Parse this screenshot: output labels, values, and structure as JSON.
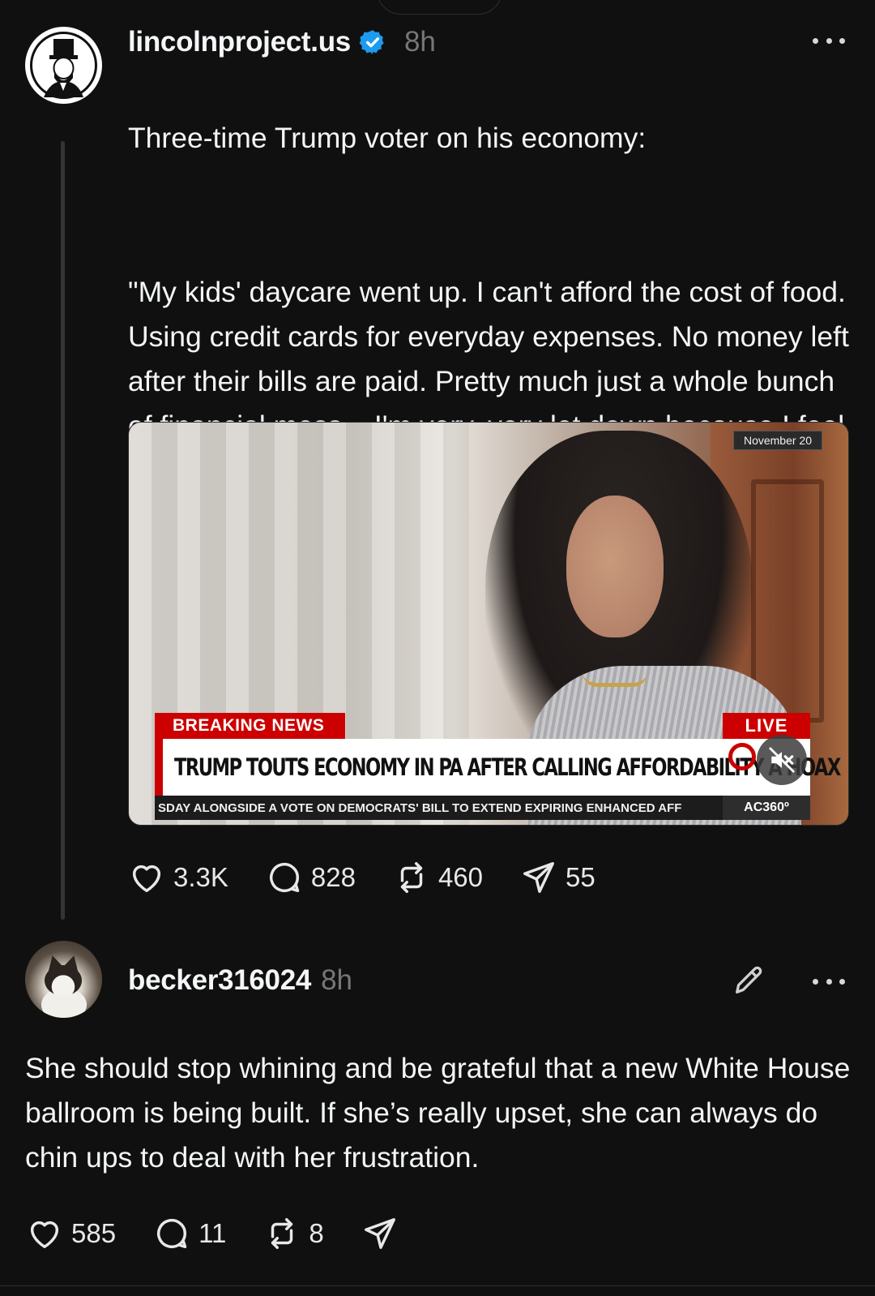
{
  "post": {
    "username": "lincolnproject.us",
    "verified": true,
    "time": "8h",
    "text_intro": "Three-time Trump voter on his economy:",
    "text_quote": "\"My kids' daycare went up. I can't afford the cost of food. Using credit cards for everyday expenses. No money left after their bills are paid. Pretty much just a whole bunch of financial mess... I'm very, very let down because I feel like it's only gotten worse.\"",
    "video": {
      "date_tag": "November 20",
      "breaking_label": "BREAKING NEWS",
      "live_label": "LIVE",
      "headline": "TRUMP TOUTS ECONOMY IN PA AFTER CALLING AFFORDABILITY A HOAX",
      "ticker": "SDAY ALONGSIDE A VOTE ON DEMOCRATS' BILL TO EXTEND EXPIRING ENHANCED AFF",
      "show_tag": "AC360º",
      "mute_icon": "speaker-muted-icon"
    },
    "actions": {
      "likes": "3.3K",
      "replies": "828",
      "reposts": "460",
      "shares": "55"
    }
  },
  "reply": {
    "username": "becker316024",
    "time": "8h",
    "text": "She should stop whining and be grateful that a new White House ballroom is being built. If she’s really upset, she can always do chin ups to deal with her frustration.",
    "actions": {
      "likes": "585",
      "replies": "11",
      "reposts": "8"
    }
  },
  "colors": {
    "background": "#101010",
    "text": "#f3f5f7",
    "muted": "#777777",
    "verified": "#1d9bf0",
    "cnn_red": "#cc0000"
  }
}
